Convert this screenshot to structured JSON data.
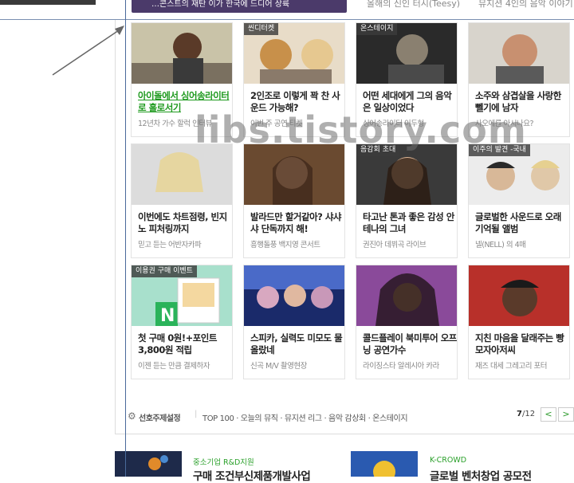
{
  "top_strip": {
    "partial_title": "…콘스트의 재탄 이가 한국에 드디어 상륙",
    "partial_sub1": "올해의 신인 터시(Teesy)",
    "partial_sub2": "뮤지션 4인의 음악 이야기"
  },
  "cards": [
    {
      "badge": "",
      "title": "아이돌에서 싱어송라이터로 홀로서기",
      "sub": "12년차 가수 할럭 인터뷰",
      "link": true
    },
    {
      "badge": "씬디터켓",
      "title": "2인조로 이렇게 꽉 찬 사운드 가능해?",
      "sub": "이번 주 공연 티켓",
      "link": false
    },
    {
      "badge": "온스테이지",
      "title": "어떤 세대에게 그의 음악은 일상이었다",
      "sub": "싱어송라이터 이두형",
      "link": false
    },
    {
      "badge": "",
      "title": "소주와 삼겹살을 사랑한 뻴기에 남자",
      "sub": "사오에를 아시나요?",
      "link": false
    },
    {
      "badge": "",
      "title": "이번에도 차트점령, 빈지노 피처링까지",
      "sub": "믿고 듣는 어반자카파",
      "link": false
    },
    {
      "badge": "",
      "title": "발라드만 할거같아? 샤샤샤 단독까지 해!",
      "sub": "흥행돌풍 백지영 콘서트",
      "link": false
    },
    {
      "badge": "음감회 초대",
      "title": "타고난 톤과 좋은 감성 안테나의 그녀",
      "sub": "권진아 데뷔곡 라이브",
      "link": false
    },
    {
      "badge": "이주의 발견 -국내",
      "title": "글로벌한 사운드로 오래 기억될 앨범",
      "sub": "넬(NELL) 의 4매",
      "link": false
    },
    {
      "badge": "이용권 구매 이벤트",
      "title": "첫 구매 0원!+포인트 3,800원 적립",
      "sub": "이젠 듣는 만큼 결제하자",
      "link": false
    },
    {
      "badge": "",
      "title": "스피카, 실력도 미모도 물 올랐네",
      "sub": "신곡 M/V 촬영현장",
      "link": false
    },
    {
      "badge": "",
      "title": "콜드플레이 북미투어 오프닝 공연가수",
      "sub": "라이징스타 알레시아 카라",
      "link": false
    },
    {
      "badge": "",
      "title": "지친 마음을 달래주는 빵모자아저씨",
      "sub": "재즈 대세 그레고리 포터",
      "link": false
    }
  ],
  "footer": {
    "pref_label": "선호주제설정",
    "links": "TOP 100 · 오늘의 뮤직 · 뮤지션 리그 · 음악 감상회 · 온스테이지",
    "page_current": "7",
    "page_total": "/12",
    "prev_icon": "chevron-left-icon",
    "next_icon": "chevron-right-icon"
  },
  "ads": [
    {
      "category": "중소기업 R&D지원",
      "title": "구매 조건부신제품개발사업"
    },
    {
      "category": "K-CROWD",
      "title": "글로벌 벤처창업 공모전"
    }
  ],
  "watermark": "libs.tistory.com",
  "colors": {
    "accent_green": "#1e9a1e",
    "badge_bg": "#3c3c3c",
    "guide_line": "#4a6a9a"
  }
}
